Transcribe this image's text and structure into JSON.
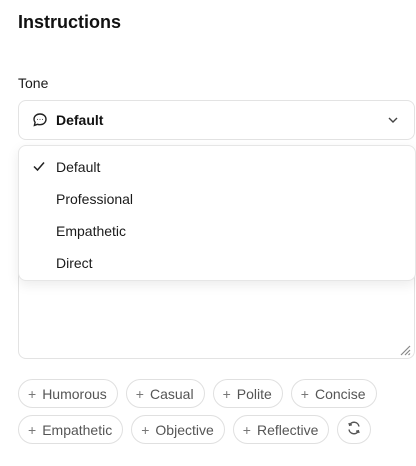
{
  "title": "Instructions",
  "tone": {
    "label": "Tone",
    "selected": "Default",
    "options": [
      "Default",
      "Professional",
      "Empathetic",
      "Direct"
    ]
  },
  "chips": {
    "row1": [
      "Humorous",
      "Casual",
      "Polite",
      "Concise"
    ],
    "row2": [
      "Empathetic",
      "Objective",
      "Reflective"
    ],
    "plus_symbol": "+"
  }
}
